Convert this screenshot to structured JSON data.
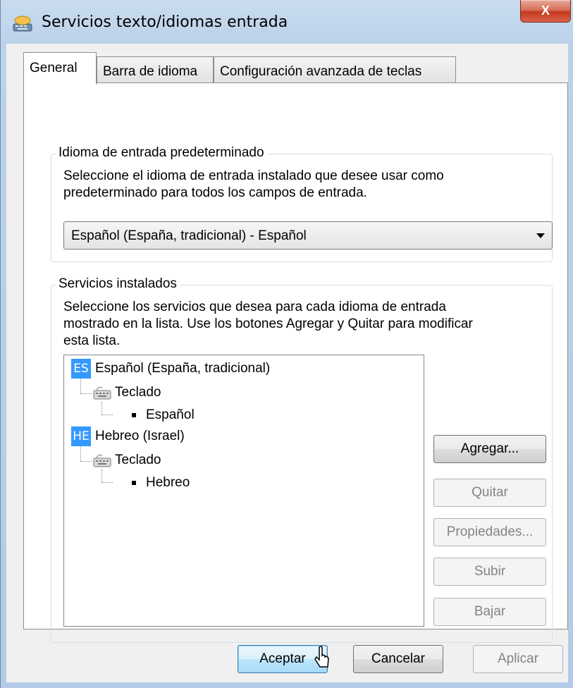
{
  "window": {
    "title": "Servicios texto/idiomas entrada",
    "close_label": "X"
  },
  "tabs": [
    {
      "label": "General",
      "active": true
    },
    {
      "label": "Barra de idioma",
      "active": false
    },
    {
      "label": "Configuración avanzada de teclas",
      "active": false
    }
  ],
  "default_language": {
    "group_label": "Idioma de entrada predeterminado",
    "description_line1": "Seleccione el idioma de entrada instalado que desee usar como",
    "description_line2": "predeterminado para todos los campos de entrada.",
    "selected": "Español (España, tradicional) - Español"
  },
  "installed_services": {
    "group_label": "Servicios instalados",
    "description_line1": "Seleccione los servicios que desea para cada idioma de entrada",
    "description_line2": "mostrado en la lista. Use los botones Agregar y Quitar para modificar",
    "description_line3": "esta lista.",
    "tree": [
      {
        "badge": "ES",
        "language": "Español (España, tradicional)",
        "category": "Teclado",
        "layout": "Español"
      },
      {
        "badge": "HE",
        "language": "Hebreo (Israel)",
        "category": "Teclado",
        "layout": "Hebreo"
      }
    ],
    "buttons": {
      "add": "Agregar...",
      "remove": "Quitar",
      "properties": "Propiedades...",
      "move_up": "Subir",
      "move_down": "Bajar"
    }
  },
  "footer": {
    "ok": "Aceptar",
    "cancel": "Cancelar",
    "apply": "Aplicar"
  },
  "colors": {
    "language_badge": "#3399ff",
    "close_button": "#c43a1e"
  }
}
